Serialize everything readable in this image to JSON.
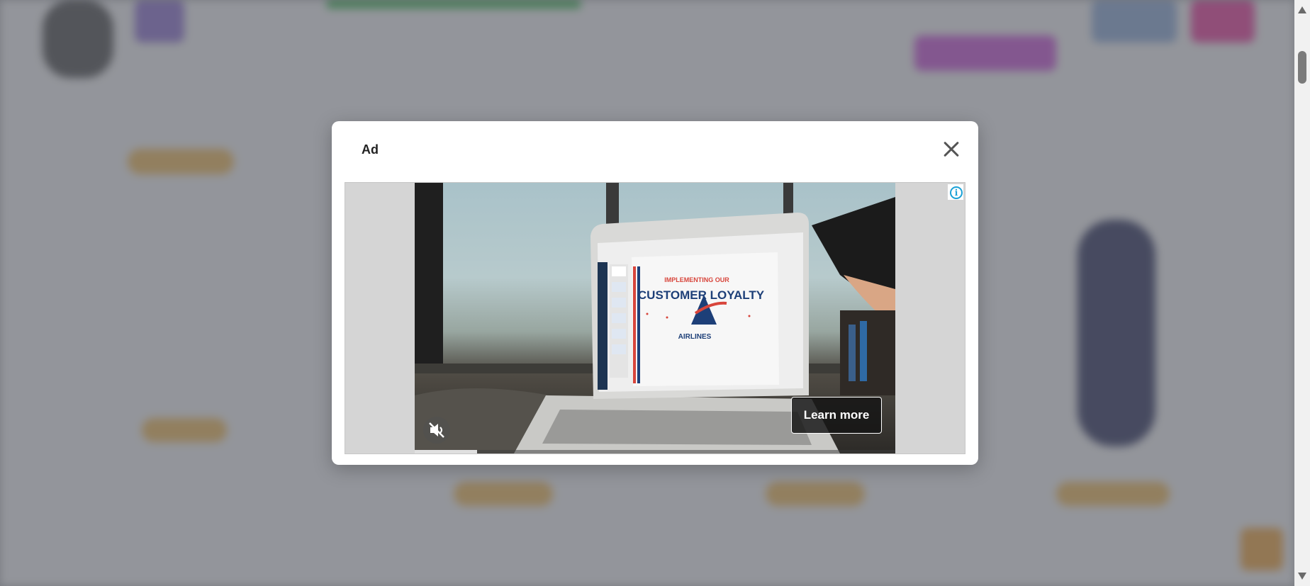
{
  "modal": {
    "title": "Ad",
    "close_icon": "close-icon",
    "info_icon": "info-icon",
    "info_glyph": "i"
  },
  "ad": {
    "slide_heading_small": "IMPLEMENTING OUR",
    "slide_heading_large": "CUSTOMER LOYALTY",
    "slide_logo_text": "AIRLINES",
    "cta_label": "Learn more",
    "mute_icon": "muted-speaker-icon",
    "progress": 0.13
  },
  "colors": {
    "accent_info": "#1aa1d6",
    "slide_red": "#d8453b",
    "slide_blue": "#1d3f78"
  }
}
